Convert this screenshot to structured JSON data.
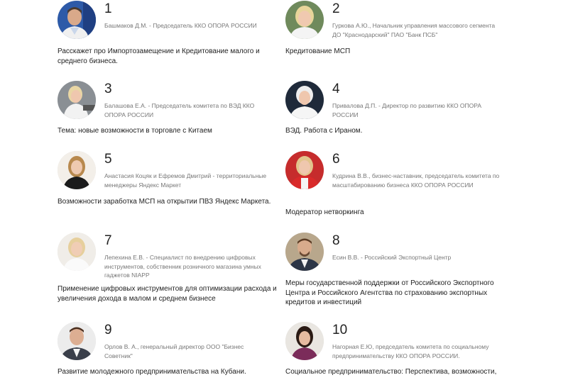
{
  "speakers": [
    {
      "number": "1",
      "role": "Башмаков Д.М. - Председатель ККО ОПОРА РОССИИ",
      "topic": "Расскажет про Импортозамещение и Кредитование малого и среднего бизнеса."
    },
    {
      "number": "2",
      "role": "Гуркова А.Ю., Начальник управления массового сегмента ДО \"Краснодарский\" ПАО \"Банк ПСБ\"",
      "topic": "Кредитование МСП"
    },
    {
      "number": "3",
      "role": "Балашова Е.А. - Председатель комитета по ВЭД ККО ОПОРА РОССИИ",
      "topic": "Тема: новые возможности в торговле с Китаем"
    },
    {
      "number": "4",
      "role": "Привалова Д.П. - Директор по развитию ККО ОПОРА РОССИИ",
      "topic": "ВЭД. Работа с Ираном."
    },
    {
      "number": "5",
      "role": "Анастасия Коцяк и Ефремов Дмитрий - территориальные менеджеры Яндекс Маркет",
      "topic": "Возможности заработка МСП на открытии ПВЗ Яндекс Маркета."
    },
    {
      "number": "6",
      "role": "Кудрина В.В., бизнес-наставник, председатель комитета по масштабированию бизнеса ККО ОПОРА РОССИИ",
      "topic": "Модератор нетворкинга"
    },
    {
      "number": "7",
      "role": "Лепехина Е.В. - Специалист по внедрению цифровых инструментов, собственник розничного магазина умных гаджетов NIAPP",
      "topic": "Применение цифровых инструментов для оптимизации расхода и увеличения дохода в малом и среднем бизнесе"
    },
    {
      "number": "8",
      "role": "Есин В.В. - Российский Экспортный Центр",
      "topic": "Меры государственной поддержки от Российского Экспортного Центра и Российского Агентства по страхованию экспортных кредитов и инвестиций"
    },
    {
      "number": "9",
      "role": "Орлов В. А., генеральный директор ООО \"Бизнес Советник\"",
      "topic": "Развитие молодежного предпринимательства на Кубани."
    },
    {
      "number": "10",
      "role": "Нагорная Е.Ю, председатель комитета по социальному предпринимательству ККО ОПОРА РОССИИ.",
      "topic": "Социальное предпринимательство: Перспектива, возможности,"
    }
  ]
}
